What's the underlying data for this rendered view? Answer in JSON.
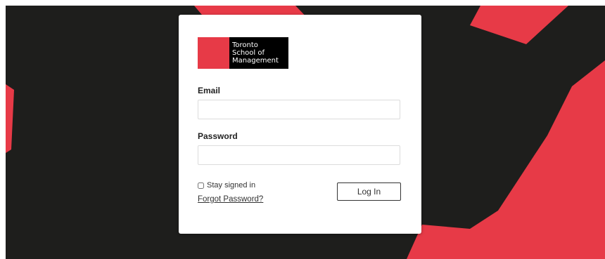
{
  "branding": {
    "logo_lines": [
      "Toronto",
      "School of",
      "Management"
    ],
    "accent_color": "#e73a47",
    "background_color": "#1e1e1c"
  },
  "form": {
    "email_label": "Email",
    "email_value": "",
    "password_label": "Password",
    "password_value": "",
    "stay_signed_in_label": "Stay signed in",
    "stay_signed_in_checked": false,
    "forgot_password_label": "Forgot Password?",
    "login_button_label": "Log In"
  }
}
